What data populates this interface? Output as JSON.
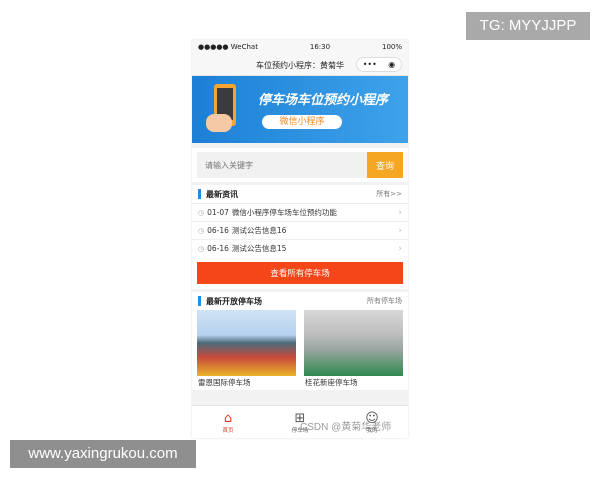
{
  "overlay": {
    "tag": "TG: MYYJJPP",
    "url": "www.yaxingrukou.com",
    "watermark": "CSDN @黄菊华老师"
  },
  "status_bar": {
    "carrier": "●●●●● WeChat",
    "time": "16:30",
    "battery": "100%"
  },
  "nav_bar": {
    "title": "车位预约小程序：黄菊华",
    "menu_glyph": "•••",
    "close_glyph": "◉"
  },
  "banner": {
    "title": "停车场车位预约小程序",
    "badge": "微信小程序"
  },
  "search": {
    "placeholder": "请输入关键字",
    "button": "查询"
  },
  "news": {
    "title": "最新资讯",
    "more": "所有>>",
    "items": [
      {
        "date": "01-07",
        "text": "微信小程序停车场车位预约功能"
      },
      {
        "date": "06-16",
        "text": "测试公告信息16"
      },
      {
        "date": "06-16",
        "text": "测试公告信息15"
      }
    ]
  },
  "view_all_button": "查看所有停车场",
  "lots": {
    "title": "最新开放停车场",
    "more": "所有停车场",
    "items": [
      {
        "name": "雷恩国际停车场"
      },
      {
        "name": "桂花新座停车场"
      }
    ]
  },
  "tabbar": {
    "items": [
      {
        "label": "首页",
        "icon": "home-icon"
      },
      {
        "label": "停车场",
        "icon": "grid-icon"
      },
      {
        "label": "我的",
        "icon": "user-icon"
      }
    ],
    "active_color": "#e03a2a"
  },
  "colors": {
    "accent_blue": "#1f8fe5",
    "search_button": "#f5a623",
    "view_all_button": "#f5461a"
  }
}
